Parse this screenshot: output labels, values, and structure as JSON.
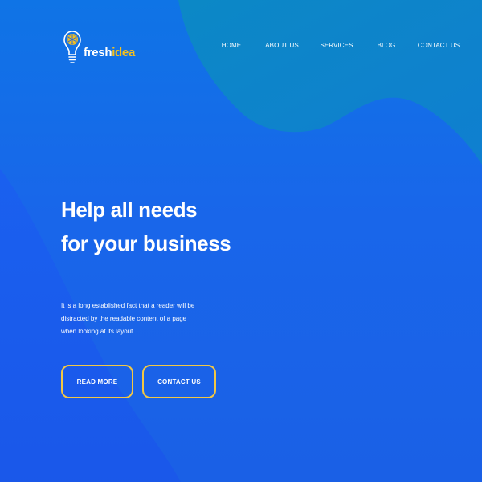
{
  "brand": {
    "name_part1": "fresh",
    "name_part2": "idea",
    "logo_icon": "lightbulb-icon",
    "colors": {
      "accent_yellow": "#f6c11c",
      "text_white": "#ffffff",
      "bg_blue": "#1a62e8",
      "blob_blue": "#0f86c9"
    }
  },
  "nav": {
    "items": [
      {
        "label": "HOME"
      },
      {
        "label": "ABOUT US"
      },
      {
        "label": "SERVICES"
      },
      {
        "label": "BLOG"
      },
      {
        "label": "CONTACT US"
      }
    ]
  },
  "hero": {
    "headline_line1": "Help all needs",
    "headline_line2": "for your business",
    "description": "It is a long established fact that a reader will be distracted by the readable content of a page when looking at its layout.",
    "primary_button": "READ MORE",
    "secondary_button": "CONTACT US"
  }
}
